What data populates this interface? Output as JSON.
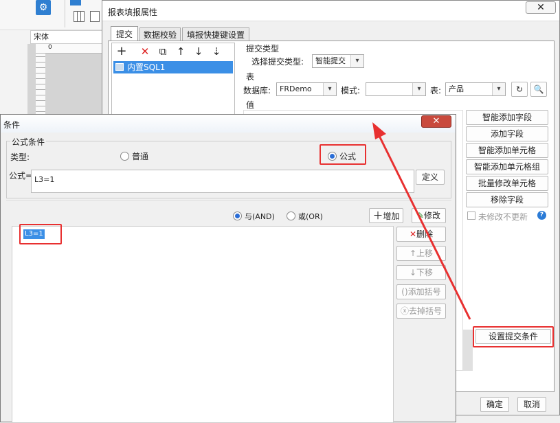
{
  "editor": {
    "font_value": "宋体",
    "ruler_zero": "0"
  },
  "report_dialog": {
    "title": "报表填报属性",
    "tabs": [
      "提交",
      "数据校验",
      "填报快捷键设置"
    ],
    "tree_items": [
      "内置SQL1"
    ],
    "submit_type_group": "提交类型",
    "submit_type_label": "选择提交类型:",
    "submit_type_value": "智能提交",
    "table_group": "表",
    "db_label": "数据库:",
    "db_value": "FRDemo",
    "mode_label": "模式:",
    "mode_value": "",
    "table_label": "表:",
    "table_value": "产品",
    "value_group": "值",
    "side_buttons": [
      "智能添加字段",
      "添加字段",
      "智能添加单元格",
      "智能添加单元格组",
      "批量修改单元格",
      "移除字段"
    ],
    "no_update_label": "未修改不更新",
    "help_icon_text": "?",
    "set_condition_button": "设置提交条件",
    "ok_button": "确定",
    "cancel_button": "取消"
  },
  "condition_dialog": {
    "title": "条件",
    "group_title": "公式条件",
    "type_label": "类型:",
    "type_normal": "普通",
    "type_formula": "公式",
    "formula_label": "公式=",
    "formula_value": "L3=1",
    "define_button": "定义",
    "and_label": "与(AND)",
    "or_label": "或(OR)",
    "add_button": "增加",
    "modify_button": "修改",
    "delete_button": "删除",
    "up_button": "上移",
    "down_button": "下移",
    "add_bracket_button": "添加括号",
    "remove_bracket_button": "去掉括号",
    "conditions": [
      "L3=1"
    ]
  }
}
